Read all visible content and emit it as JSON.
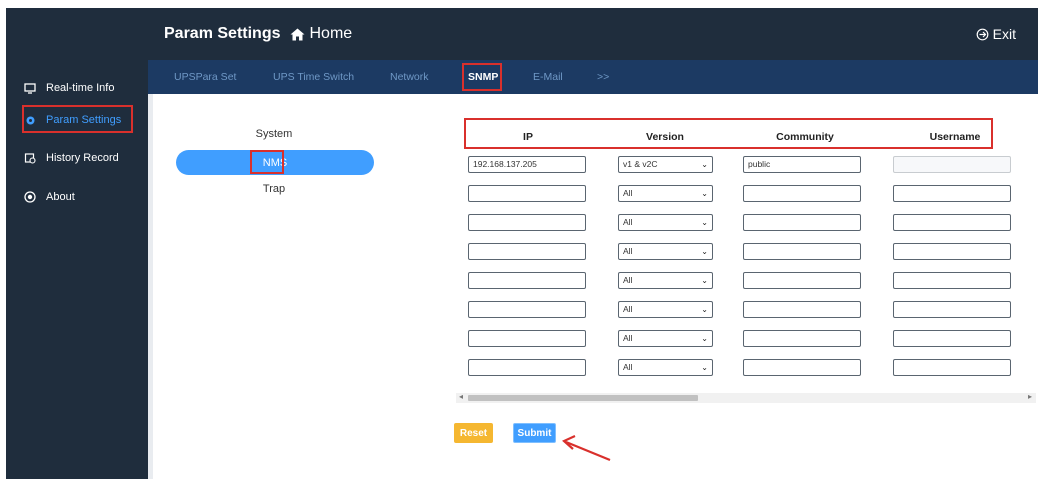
{
  "header": {
    "title": "Param Settings",
    "home_label": "Home",
    "exit_label": "Exit"
  },
  "sidebar": {
    "items": [
      {
        "label": "Real-time Info",
        "icon": "monitor-icon"
      },
      {
        "label": "Param Settings",
        "icon": "gear-icon",
        "active": true
      },
      {
        "label": "History Record",
        "icon": "history-icon"
      },
      {
        "label": "About",
        "icon": "info-circle-icon"
      }
    ]
  },
  "tabs": [
    {
      "label": "UPSPara Set"
    },
    {
      "label": "UPS Time Switch"
    },
    {
      "label": "Network"
    },
    {
      "label": "SNMP",
      "active": true
    },
    {
      "label": "E-Mail"
    },
    {
      "label": ">>"
    }
  ],
  "submenu": {
    "items": [
      {
        "label": "System"
      },
      {
        "label": "NMS",
        "active": true
      },
      {
        "label": "Trap"
      }
    ]
  },
  "table": {
    "headers": [
      "IP",
      "Version",
      "Community",
      "Username"
    ],
    "rows": [
      {
        "ip": "192.168.137.205",
        "version": "v1 & v2C",
        "community": "public",
        "username": ""
      },
      {
        "ip": "",
        "version": "All",
        "community": "",
        "username": ""
      },
      {
        "ip": "",
        "version": "All",
        "community": "",
        "username": ""
      },
      {
        "ip": "",
        "version": "All",
        "community": "",
        "username": ""
      },
      {
        "ip": "",
        "version": "All",
        "community": "",
        "username": ""
      },
      {
        "ip": "",
        "version": "All",
        "community": "",
        "username": ""
      },
      {
        "ip": "",
        "version": "All",
        "community": "",
        "username": ""
      },
      {
        "ip": "",
        "version": "All",
        "community": "",
        "username": ""
      }
    ]
  },
  "buttons": {
    "reset": "Reset",
    "submit": "Submit"
  },
  "colors": {
    "sidebar_bg": "#1f2d3d",
    "tabbar_bg": "#1c3a63",
    "accent": "#409eff",
    "reset": "#f5b731",
    "highlight_box": "#d9302c"
  }
}
